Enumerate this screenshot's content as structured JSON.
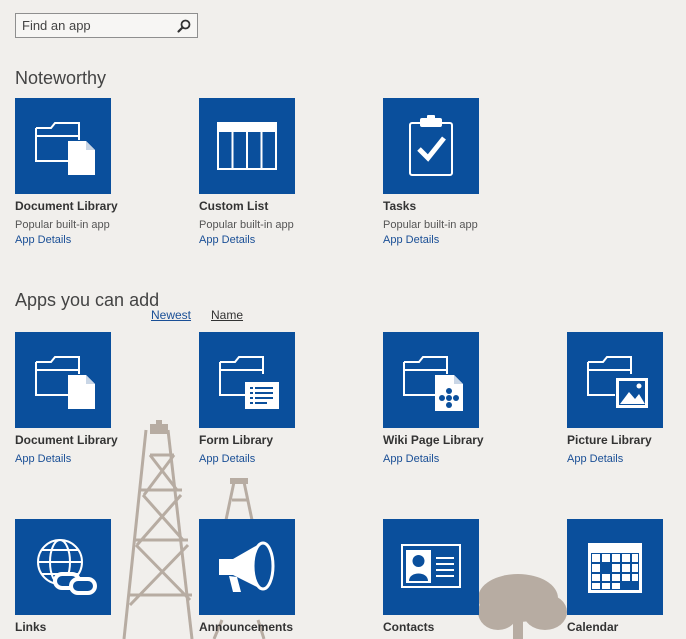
{
  "search": {
    "placeholder": "Find an app",
    "icon": "search-icon"
  },
  "noteworthy": {
    "title": "Noteworthy",
    "apps": [
      {
        "name": "Document Library",
        "subtitle": "Popular built-in app",
        "details": "App Details",
        "icon": "document-library-icon"
      },
      {
        "name": "Custom List",
        "subtitle": "Popular built-in app",
        "details": "App Details",
        "icon": "custom-list-icon"
      },
      {
        "name": "Tasks",
        "subtitle": "Popular built-in app",
        "details": "App Details",
        "icon": "tasks-clipboard-icon"
      }
    ]
  },
  "apps": {
    "title": "Apps you can add",
    "sort": {
      "newest": "Newest",
      "name": "Name"
    },
    "items": [
      {
        "name": "Document Library",
        "details": "App Details",
        "icon": "document-library-icon"
      },
      {
        "name": "Form Library",
        "details": "App Details",
        "icon": "form-library-icon"
      },
      {
        "name": "Wiki Page Library",
        "details": "App Details",
        "icon": "wiki-page-library-icon"
      },
      {
        "name": "Picture Library",
        "details": "App Details",
        "icon": "picture-library-icon"
      },
      {
        "name": "Links",
        "icon": "links-globe-icon"
      },
      {
        "name": "Announcements",
        "icon": "announcements-megaphone-icon"
      },
      {
        "name": "Contacts",
        "icon": "contacts-card-icon"
      },
      {
        "name": "Calendar",
        "icon": "calendar-icon"
      }
    ]
  },
  "colors": {
    "tile": "#0a4f9c",
    "link": "#1a4f96",
    "background": "#f1efec"
  }
}
